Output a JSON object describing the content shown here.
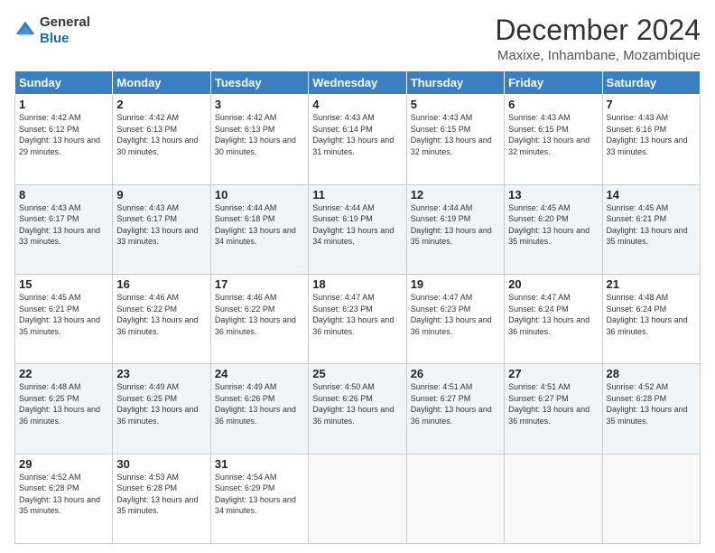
{
  "logo": {
    "line1": "General",
    "line2": "Blue"
  },
  "title": "December 2024",
  "subtitle": "Maxixe, Inhambane, Mozambique",
  "headers": [
    "Sunday",
    "Monday",
    "Tuesday",
    "Wednesday",
    "Thursday",
    "Friday",
    "Saturday"
  ],
  "weeks": [
    [
      {
        "day": "1",
        "sunrise": "Sunrise: 4:42 AM",
        "sunset": "Sunset: 6:12 PM",
        "daylight": "Daylight: 13 hours and 29 minutes."
      },
      {
        "day": "2",
        "sunrise": "Sunrise: 4:42 AM",
        "sunset": "Sunset: 6:13 PM",
        "daylight": "Daylight: 13 hours and 30 minutes."
      },
      {
        "day": "3",
        "sunrise": "Sunrise: 4:42 AM",
        "sunset": "Sunset: 6:13 PM",
        "daylight": "Daylight: 13 hours and 30 minutes."
      },
      {
        "day": "4",
        "sunrise": "Sunrise: 4:43 AM",
        "sunset": "Sunset: 6:14 PM",
        "daylight": "Daylight: 13 hours and 31 minutes."
      },
      {
        "day": "5",
        "sunrise": "Sunrise: 4:43 AM",
        "sunset": "Sunset: 6:15 PM",
        "daylight": "Daylight: 13 hours and 32 minutes."
      },
      {
        "day": "6",
        "sunrise": "Sunrise: 4:43 AM",
        "sunset": "Sunset: 6:15 PM",
        "daylight": "Daylight: 13 hours and 32 minutes."
      },
      {
        "day": "7",
        "sunrise": "Sunrise: 4:43 AM",
        "sunset": "Sunset: 6:16 PM",
        "daylight": "Daylight: 13 hours and 33 minutes."
      }
    ],
    [
      {
        "day": "8",
        "sunrise": "Sunrise: 4:43 AM",
        "sunset": "Sunset: 6:17 PM",
        "daylight": "Daylight: 13 hours and 33 minutes."
      },
      {
        "day": "9",
        "sunrise": "Sunrise: 4:43 AM",
        "sunset": "Sunset: 6:17 PM",
        "daylight": "Daylight: 13 hours and 33 minutes."
      },
      {
        "day": "10",
        "sunrise": "Sunrise: 4:44 AM",
        "sunset": "Sunset: 6:18 PM",
        "daylight": "Daylight: 13 hours and 34 minutes."
      },
      {
        "day": "11",
        "sunrise": "Sunrise: 4:44 AM",
        "sunset": "Sunset: 6:19 PM",
        "daylight": "Daylight: 13 hours and 34 minutes."
      },
      {
        "day": "12",
        "sunrise": "Sunrise: 4:44 AM",
        "sunset": "Sunset: 6:19 PM",
        "daylight": "Daylight: 13 hours and 35 minutes."
      },
      {
        "day": "13",
        "sunrise": "Sunrise: 4:45 AM",
        "sunset": "Sunset: 6:20 PM",
        "daylight": "Daylight: 13 hours and 35 minutes."
      },
      {
        "day": "14",
        "sunrise": "Sunrise: 4:45 AM",
        "sunset": "Sunset: 6:21 PM",
        "daylight": "Daylight: 13 hours and 35 minutes."
      }
    ],
    [
      {
        "day": "15",
        "sunrise": "Sunrise: 4:45 AM",
        "sunset": "Sunset: 6:21 PM",
        "daylight": "Daylight: 13 hours and 35 minutes."
      },
      {
        "day": "16",
        "sunrise": "Sunrise: 4:46 AM",
        "sunset": "Sunset: 6:22 PM",
        "daylight": "Daylight: 13 hours and 36 minutes."
      },
      {
        "day": "17",
        "sunrise": "Sunrise: 4:46 AM",
        "sunset": "Sunset: 6:22 PM",
        "daylight": "Daylight: 13 hours and 36 minutes."
      },
      {
        "day": "18",
        "sunrise": "Sunrise: 4:47 AM",
        "sunset": "Sunset: 6:23 PM",
        "daylight": "Daylight: 13 hours and 36 minutes."
      },
      {
        "day": "19",
        "sunrise": "Sunrise: 4:47 AM",
        "sunset": "Sunset: 6:23 PM",
        "daylight": "Daylight: 13 hours and 36 minutes."
      },
      {
        "day": "20",
        "sunrise": "Sunrise: 4:47 AM",
        "sunset": "Sunset: 6:24 PM",
        "daylight": "Daylight: 13 hours and 36 minutes."
      },
      {
        "day": "21",
        "sunrise": "Sunrise: 4:48 AM",
        "sunset": "Sunset: 6:24 PM",
        "daylight": "Daylight: 13 hours and 36 minutes."
      }
    ],
    [
      {
        "day": "22",
        "sunrise": "Sunrise: 4:48 AM",
        "sunset": "Sunset: 6:25 PM",
        "daylight": "Daylight: 13 hours and 36 minutes."
      },
      {
        "day": "23",
        "sunrise": "Sunrise: 4:49 AM",
        "sunset": "Sunset: 6:25 PM",
        "daylight": "Daylight: 13 hours and 36 minutes."
      },
      {
        "day": "24",
        "sunrise": "Sunrise: 4:49 AM",
        "sunset": "Sunset: 6:26 PM",
        "daylight": "Daylight: 13 hours and 36 minutes."
      },
      {
        "day": "25",
        "sunrise": "Sunrise: 4:50 AM",
        "sunset": "Sunset: 6:26 PM",
        "daylight": "Daylight: 13 hours and 36 minutes."
      },
      {
        "day": "26",
        "sunrise": "Sunrise: 4:51 AM",
        "sunset": "Sunset: 6:27 PM",
        "daylight": "Daylight: 13 hours and 36 minutes."
      },
      {
        "day": "27",
        "sunrise": "Sunrise: 4:51 AM",
        "sunset": "Sunset: 6:27 PM",
        "daylight": "Daylight: 13 hours and 36 minutes."
      },
      {
        "day": "28",
        "sunrise": "Sunrise: 4:52 AM",
        "sunset": "Sunset: 6:28 PM",
        "daylight": "Daylight: 13 hours and 35 minutes."
      }
    ],
    [
      {
        "day": "29",
        "sunrise": "Sunrise: 4:52 AM",
        "sunset": "Sunset: 6:28 PM",
        "daylight": "Daylight: 13 hours and 35 minutes."
      },
      {
        "day": "30",
        "sunrise": "Sunrise: 4:53 AM",
        "sunset": "Sunset: 6:28 PM",
        "daylight": "Daylight: 13 hours and 35 minutes."
      },
      {
        "day": "31",
        "sunrise": "Sunrise: 4:54 AM",
        "sunset": "Sunset: 6:29 PM",
        "daylight": "Daylight: 13 hours and 34 minutes."
      },
      null,
      null,
      null,
      null
    ]
  ]
}
